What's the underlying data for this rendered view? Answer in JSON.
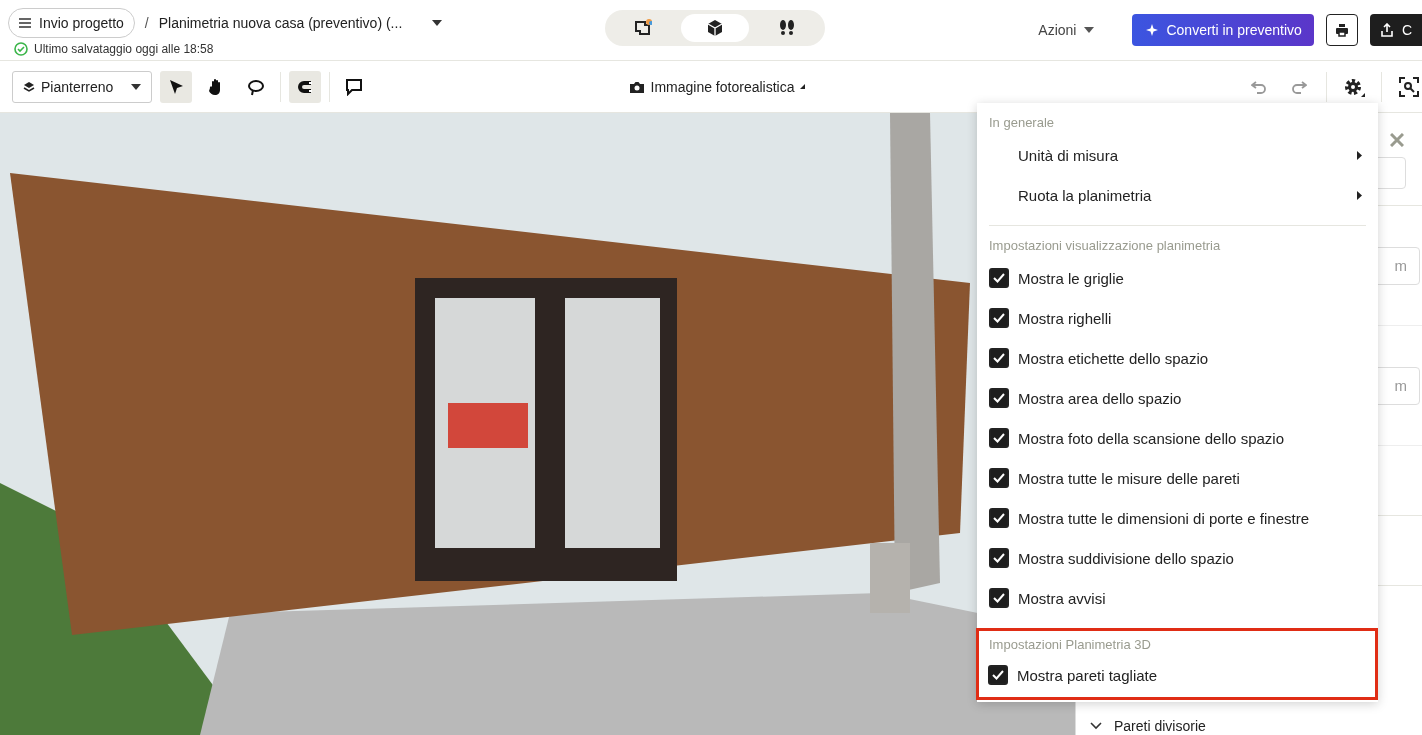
{
  "header": {
    "project_button": "Invio progetto",
    "separator": "/",
    "project_title": "Planimetria nuova casa (preventivo) (...",
    "save_status": "Ultimo salvataggio oggi alle 18:58"
  },
  "view_modes": [
    {
      "kind": "plan",
      "selected": false
    },
    {
      "kind": "cube",
      "selected": true
    },
    {
      "kind": "walk",
      "selected": false
    }
  ],
  "actions_menu": "Azioni",
  "convert_button": "Converti in preventivo",
  "export_button": "C",
  "toolbar": {
    "floor": "Pianterreno",
    "tools": [
      {
        "kind": "select",
        "selected": true
      },
      {
        "kind": "pan",
        "selected": false
      },
      {
        "kind": "lasso",
        "selected": false
      },
      {
        "kind": "magnet",
        "selected": true
      },
      {
        "kind": "comment",
        "selected": false
      }
    ],
    "render_button": "Immagine fotorealistica"
  },
  "settings_menu": {
    "sections": [
      {
        "title": "In generale",
        "highlighted": false,
        "items": [
          {
            "kind": "submenu",
            "label": "Unità di misura"
          },
          {
            "kind": "submenu",
            "label": "Ruota la planimetria"
          }
        ]
      },
      {
        "title": "Impostazioni visualizzazione planimetria",
        "highlighted": false,
        "items": [
          {
            "kind": "checkbox",
            "label": "Mostra le griglie",
            "checked": true
          },
          {
            "kind": "checkbox",
            "label": "Mostra righelli",
            "checked": true
          },
          {
            "kind": "checkbox",
            "label": "Mostra etichette dello spazio",
            "checked": true
          },
          {
            "kind": "checkbox",
            "label": "Mostra area dello spazio",
            "checked": true
          },
          {
            "kind": "checkbox",
            "label": "Mostra foto della scansione dello spazio",
            "checked": true
          },
          {
            "kind": "checkbox",
            "label": "Mostra tutte le misure delle pareti",
            "checked": true
          },
          {
            "kind": "checkbox",
            "label": "Mostra tutte le dimensioni di porte e finestre",
            "checked": true
          },
          {
            "kind": "checkbox",
            "label": "Mostra suddivisione dello spazio",
            "checked": true
          },
          {
            "kind": "checkbox",
            "label": "Mostra avvisi",
            "checked": true
          }
        ]
      },
      {
        "title": "Impostazioni Planimetria 3D",
        "highlighted": true,
        "items": [
          {
            "kind": "checkbox",
            "label": "Mostra pareti tagliate",
            "checked": true
          }
        ]
      }
    ]
  },
  "side_panel": {
    "unit_fields": [
      "m",
      "m"
    ],
    "section": "Pareti divisorie"
  }
}
